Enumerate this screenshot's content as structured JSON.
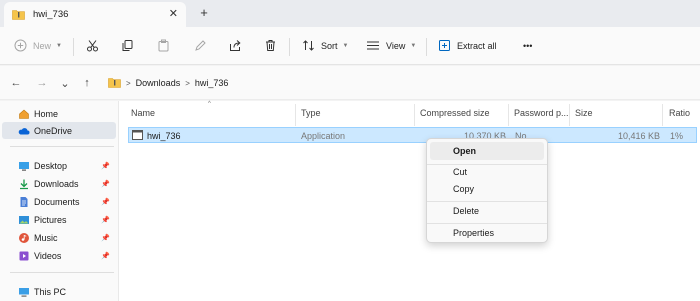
{
  "tab": {
    "title": "hwi_736",
    "close_icon": "close-icon",
    "new_tab": "+"
  },
  "toolbar": {
    "new_label": "New",
    "sort_label": "Sort",
    "view_label": "View",
    "extract_label": "Extract all",
    "more": "•••"
  },
  "nav": {
    "back": "←",
    "forward": "→",
    "recent": "⌄",
    "up": "↑"
  },
  "breadcrumb": {
    "sep": ">",
    "items": [
      "Downloads",
      "hwi_736"
    ]
  },
  "sidebar": {
    "items": [
      {
        "label": "Home",
        "icon": "home-icon"
      },
      {
        "label": "OneDrive",
        "icon": "cloud-icon",
        "active": true
      },
      {
        "label": "Desktop",
        "icon": "desktop-icon"
      },
      {
        "label": "Downloads",
        "icon": "download-icon"
      },
      {
        "label": "Documents",
        "icon": "document-icon"
      },
      {
        "label": "Pictures",
        "icon": "picture-icon"
      },
      {
        "label": "Music",
        "icon": "music-icon"
      },
      {
        "label": "Videos",
        "icon": "video-icon"
      },
      {
        "label": "This PC",
        "icon": "computer-icon"
      }
    ]
  },
  "columns": [
    "Name",
    "Type",
    "Compressed size",
    "Password p...",
    "Size",
    "Ratio"
  ],
  "files": [
    {
      "name": "hwi_736",
      "type": "Application",
      "compressed": "10,370 KB",
      "password": "No",
      "size": "10,416 KB",
      "ratio": "1%"
    }
  ],
  "context_menu": {
    "open": "Open",
    "cut": "Cut",
    "copy": "Copy",
    "delete": "Delete",
    "properties": "Properties"
  },
  "colors": {
    "selection": "#cce8ff",
    "selection_border": "#99d1ff",
    "accent": "#0067c0",
    "folder": "#f5c44b"
  }
}
